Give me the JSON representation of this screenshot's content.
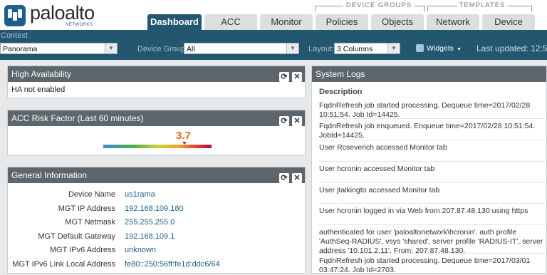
{
  "brand": {
    "name": "paloalto",
    "sub": "NETWORKS"
  },
  "tabs": [
    {
      "label": "Dashboard",
      "active": true
    },
    {
      "label": "ACC"
    },
    {
      "label": "Monitor"
    },
    {
      "label": "Policies"
    },
    {
      "label": "Objects"
    },
    {
      "label": "Network"
    },
    {
      "label": "Device"
    }
  ],
  "tab_groups": {
    "device_groups": "DEVICE GROUPS",
    "templates": "TEMPLATES"
  },
  "toolbar": {
    "context_label": "Context",
    "context_value": "Panorama",
    "device_group_label": "Device Group",
    "device_group_value": "All",
    "layout_label": "Layout:",
    "layout_value": "3 Columns",
    "widgets_label": "Widgets",
    "last_updated": "Last updated: 12:5"
  },
  "ha": {
    "title": "High Availability",
    "text": "HA not enabled"
  },
  "acc": {
    "title": "ACC Risk Factor (Last 60 minutes)",
    "value": "3.7",
    "level_fraction": 0.75
  },
  "general": {
    "title": "General Information",
    "rows": [
      {
        "key": "Device Name",
        "value": "us1rama"
      },
      {
        "key": "MGT IP Address",
        "value": "192.168.109.180"
      },
      {
        "key": "MGT Netmask",
        "value": "255.255.255.0"
      },
      {
        "key": "MGT Default Gateway",
        "value": "192.168.109.1"
      },
      {
        "key": "MGT IPv6 Address",
        "value": "unknown"
      },
      {
        "key": "MGT IPv6 Link Local Address",
        "value": "fe80::250:56ff:fe1d:ddc6/64"
      }
    ]
  },
  "logs": {
    "title": "System Logs",
    "header": "Description",
    "entries": [
      "FqdnRefresh job started processing. Dequeue time=2017/02/28 10:51:54. Job Id=14425.",
      "FqdnRefresh job enqueued. Enqueue time=2017/02/28 10:51:54. JobId=14425.",
      "User Rcseverich accessed Monitor tab",
      "User hcronin accessed Monitor tab",
      "User jtalkingto accessed Monitor tab",
      "User hcronin logged in via Web from 207.87.48.130 using https",
      "authenticated for user 'paloaltonetwork\\hcronin'. auth profile 'AuthSeq-RADIUS', vsys 'shared', server profile 'RADIUS-IT', server address '10.101.2.11', From: 207.87.48.130.",
      "FqdnRefresh job started processing. Dequeue time=2017/03/01 03:47:24. Job Id=2703."
    ]
  }
}
